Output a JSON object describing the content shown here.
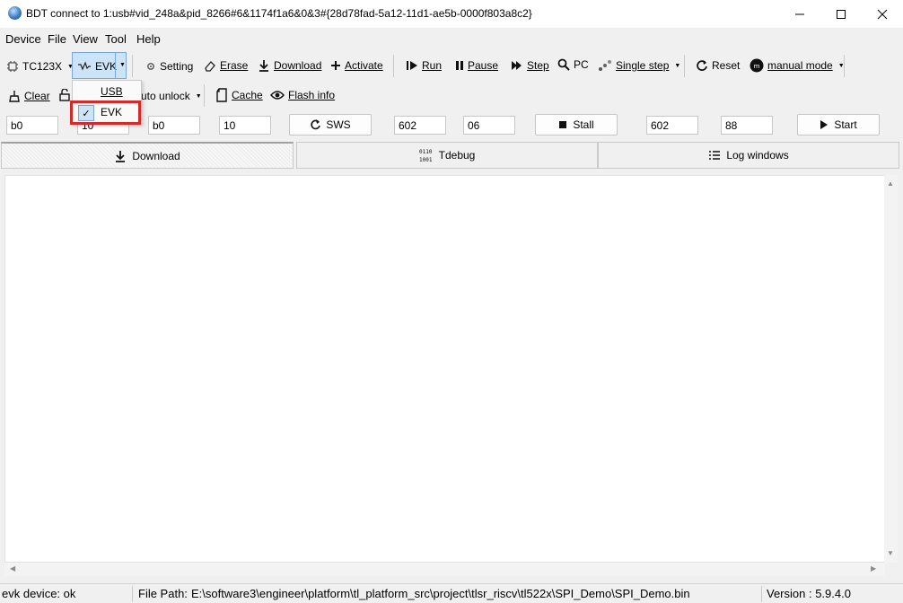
{
  "window": {
    "title": "BDT connect to 1:usb#vid_248a&pid_8266#6&1174f1a6&0&3#{28d78fad-5a12-11d1-ae5b-0000f803a8c2}"
  },
  "menu": [
    "Device",
    "File",
    "View",
    "Tool",
    "Help"
  ],
  "toolbar1": {
    "chip": "TC123X",
    "mode": "EVK",
    "setting": "Setting",
    "erase": "Erase",
    "download": "Download",
    "activate": "Activate",
    "run": "Run",
    "pause": "Pause",
    "step": "Step",
    "pc": "PC",
    "single_step": "Single step",
    "reset": "Reset",
    "manual_mode": "manual mode"
  },
  "toolbar2": {
    "clear": "Clear",
    "unlock_partial": "uto unlock",
    "cache": "Cache",
    "flash_info": "Flash info"
  },
  "inputs": {
    "addr1": "b0",
    "val1": "10",
    "addr2": "b0",
    "val2": "10",
    "sws": "SWS",
    "reg1": "602",
    "reg1val": "06",
    "stall": "Stall",
    "reg2": "602",
    "reg2val": "88",
    "start": "Start"
  },
  "tabs": [
    "Download",
    "Tdebug",
    "Log windows"
  ],
  "dropdown": {
    "items": [
      "USB",
      "EVK"
    ],
    "selected": "EVK",
    "checkmark": "✓"
  },
  "status": {
    "device": "evk device: ok",
    "file_path_label": "File Path:",
    "file_path": "E:\\software3\\engineer\\platform\\tl_platform_src\\project\\tlsr_riscv\\tl522x\\SPI_Demo\\SPI_Demo.bin",
    "version": "Version : 5.9.4.0"
  },
  "colors": {
    "highlight_box": "#d42a2a",
    "selected_combo": "#cfe3f7"
  }
}
